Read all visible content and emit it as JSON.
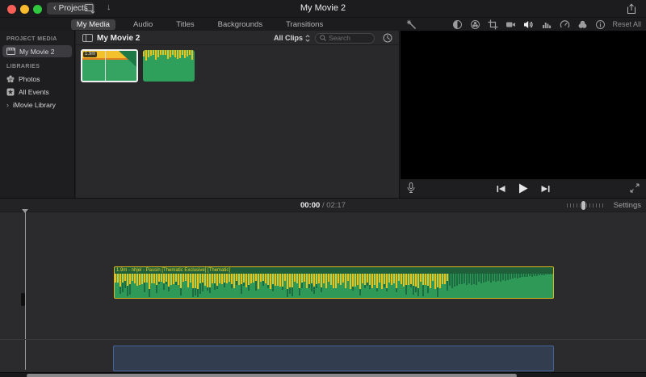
{
  "titlebar": {
    "projects_label": "Projects",
    "back_chevron": "‹",
    "import_arrow": "↓",
    "title": "My Movie 2"
  },
  "tabs": [
    {
      "label": "My Media",
      "active": true
    },
    {
      "label": "Audio",
      "active": false
    },
    {
      "label": "Titles",
      "active": false
    },
    {
      "label": "Backgrounds",
      "active": false
    },
    {
      "label": "Transitions",
      "active": false
    }
  ],
  "sidebar": {
    "sections": [
      {
        "header": "PROJECT MEDIA",
        "items": [
          {
            "label": "My Movie 2",
            "icon": "clapperboard",
            "selected": true
          }
        ]
      },
      {
        "header": "LIBRARIES",
        "items": [
          {
            "label": "Photos",
            "icon": "photos-flower",
            "selected": false
          },
          {
            "label": "All Events",
            "icon": "star",
            "selected": false
          },
          {
            "label": "iMovie Library",
            "icon": "disclosure-chevron",
            "disclosure": "›",
            "selected": false
          }
        ]
      }
    ]
  },
  "browser": {
    "title": "My Movie 2",
    "filter_label": "All Clips",
    "search_placeholder": "Search",
    "clips": [
      {
        "duration_badge": "1.9m",
        "selected": true,
        "type": "audio"
      },
      {
        "selected": false,
        "type": "audio"
      }
    ]
  },
  "viewer": {
    "toolbar_icons": [
      "enhance-wand",
      "color-balance",
      "color-correction",
      "crop",
      "stabilization",
      "volume",
      "noise-reduction",
      "speed",
      "clip-filter",
      "info"
    ],
    "reset_all_label": "Reset All",
    "transport_icons": [
      "voiceover-mic",
      "skip-back",
      "play",
      "skip-forward",
      "fullscreen"
    ]
  },
  "timeline": {
    "current_time": "00:00",
    "time_separator": "/",
    "total_time": "02:17",
    "settings_label": "Settings",
    "clip_title": "1.9m - nhjel - Passin [Thematic Exclusive] [Thematic]"
  },
  "colors": {
    "clip_green": "#2f9a57",
    "wave_yellow": "#e6c322",
    "selection_yellow": "#d9b91c",
    "placeholder_blue": "#46629e",
    "selected_border_white": "#f0f0f0"
  }
}
